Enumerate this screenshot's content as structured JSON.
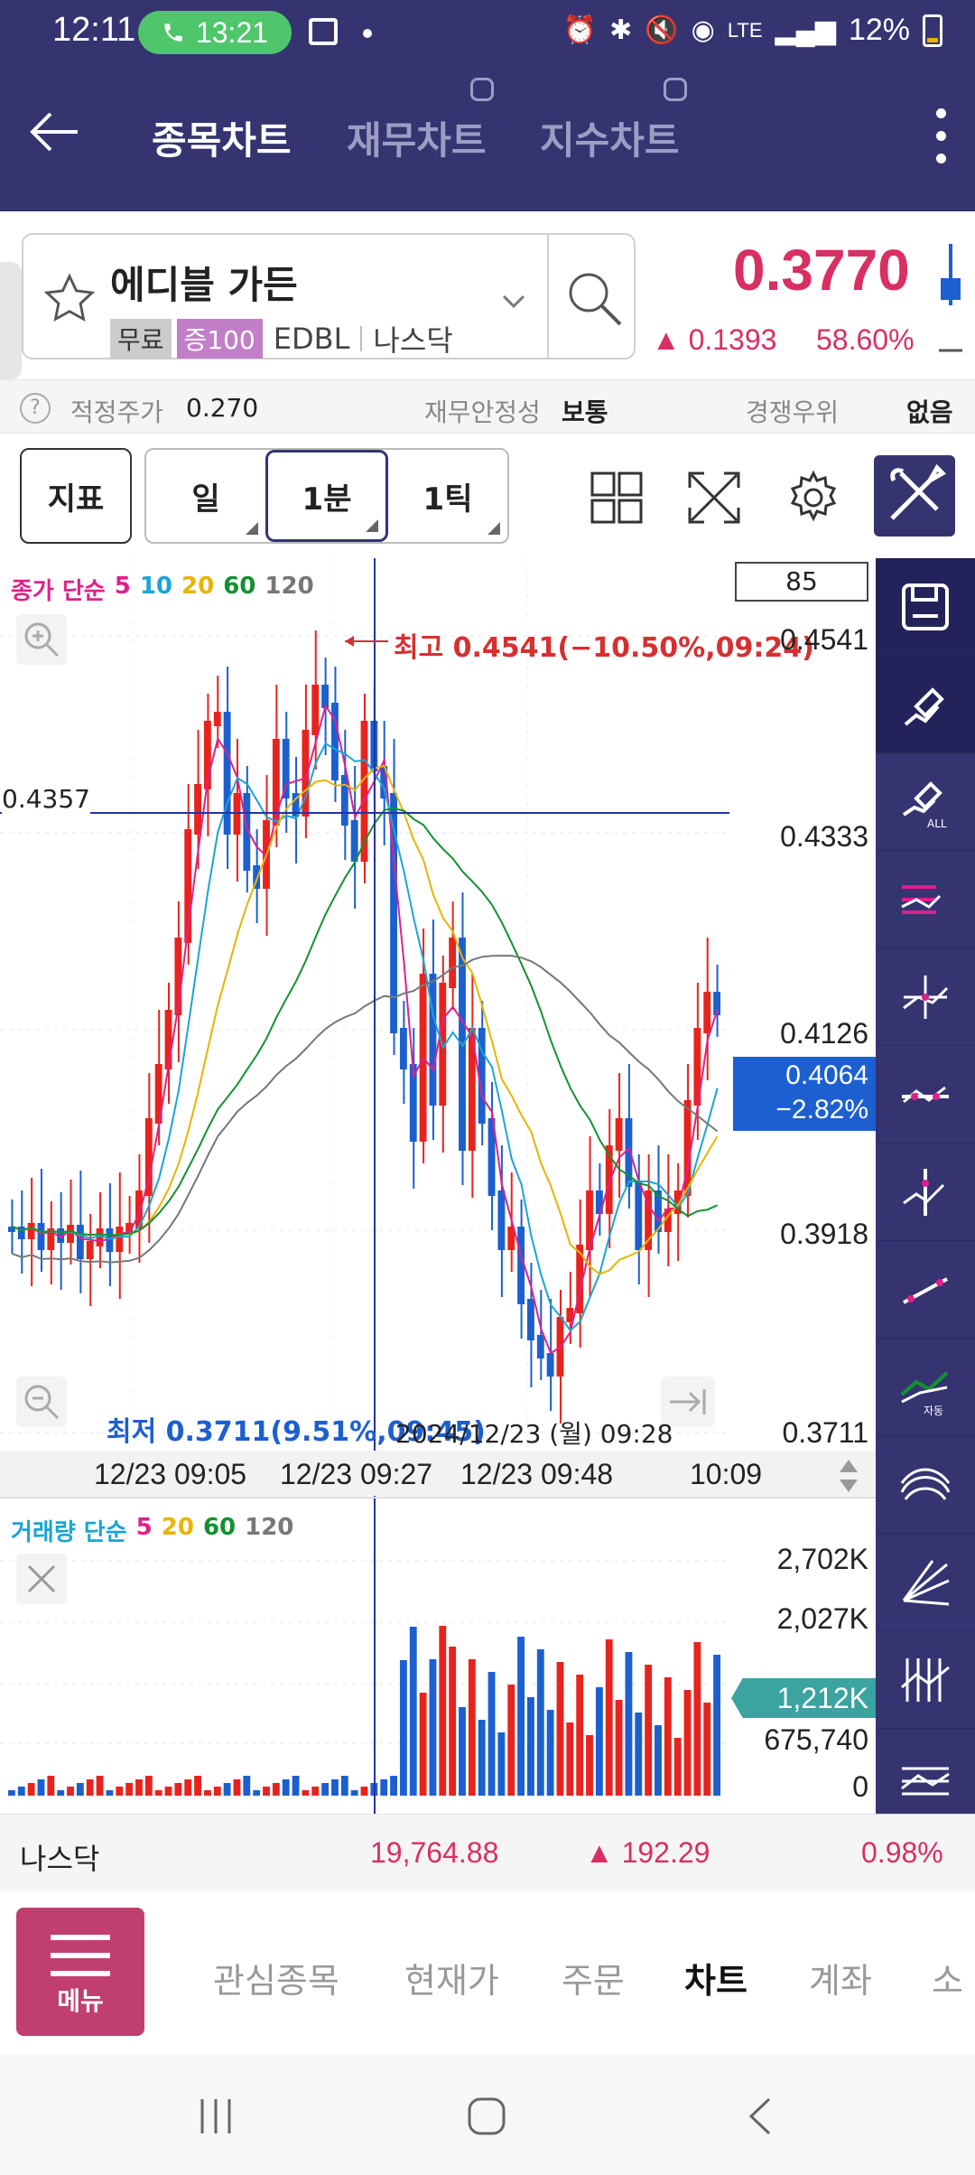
{
  "status_bar": {
    "time": "12:11",
    "call_time": "13:21",
    "battery": "12%"
  },
  "header": {
    "tabs": [
      {
        "label": "종목차트"
      },
      {
        "label": "재무차트"
      },
      {
        "label": "지수차트"
      }
    ]
  },
  "stock": {
    "name": "에디블 가든",
    "badge_free": "무료",
    "badge_margin": "증100",
    "ticker": "EDBL",
    "market": "나스닥",
    "price": "0.3770",
    "change": "▲ 0.1393",
    "change_pct": "58.60%"
  },
  "info_row": {
    "fair_price_label": "적정주가",
    "fair_price_value": "0.270",
    "stability_label": "재무안정성",
    "stability_value": "보통",
    "competition_label": "경쟁우위",
    "competition_value": "없음"
  },
  "toolbar": {
    "indicator": "지표",
    "period_day": "일",
    "period_1min": "1분",
    "period_1tick": "1틱"
  },
  "price_chart": {
    "legend_prefix": "종가 단순",
    "ma_periods": [
      "5",
      "10",
      "20",
      "60",
      "120"
    ],
    "ma_colors": [
      "#e0208a",
      "#1aa5d4",
      "#e8b400",
      "#12922f",
      "#777777"
    ],
    "count_box": "85",
    "high_label": "최고 0.4541(−10.50%,09:24)",
    "low_label": "최저 0.3711(9.51%,09:45)",
    "crosshair_price": "0.4357",
    "crosshair_time": "2024/12/23 (월) 09:28",
    "current_price": "0.4064",
    "current_change": "−2.82%",
    "y_ticks": [
      "0.4541",
      "0.4333",
      "0.4126",
      "0.3918",
      "0.3711"
    ],
    "x_ticks": [
      "12/23 09:05",
      "12/23 09:27",
      "12/23 09:48",
      "10:09"
    ]
  },
  "volume_chart": {
    "legend_prefix": "거래량 단순",
    "ma_periods": [
      "5",
      "20",
      "60",
      "120"
    ],
    "ma_colors": [
      "#e0208a",
      "#e8b400",
      "#12922f",
      "#777777"
    ],
    "y_ticks": [
      "2,702K",
      "2,027K",
      "675,740",
      "0"
    ],
    "current_volume": "1,212K"
  },
  "index_bar": {
    "name": "나스닥",
    "value": "19,764.88",
    "change": "▲ 192.29",
    "pct": "0.98%"
  },
  "bottom_nav": {
    "menu_label": "메뉴",
    "items": [
      {
        "label": "관심종목"
      },
      {
        "label": "현재가"
      },
      {
        "label": "주문"
      },
      {
        "label": "차트"
      },
      {
        "label": "계좌"
      },
      {
        "label": "소"
      }
    ]
  },
  "colors": {
    "header": "#353471",
    "up": "#d92f62",
    "candle_up": "#e8231d",
    "candle_down": "#1c5fd0",
    "current_tag": "#1c5fd0",
    "volume_tag": "#3ba3a0"
  }
}
